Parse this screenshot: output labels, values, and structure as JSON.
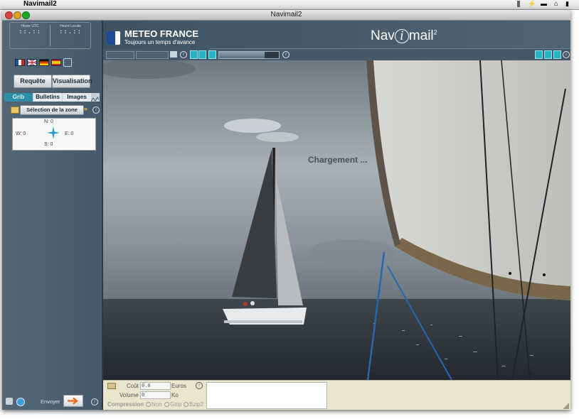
{
  "menubar": {
    "app_name": "Navimail2"
  },
  "window": {
    "title": "Navimail2"
  },
  "clocks": {
    "utc_label": "Heure UTC",
    "local_label": "Heure Locale",
    "utc_value": "::.::",
    "local_value": "::.::"
  },
  "languages": [
    "fr",
    "en",
    "de",
    "es",
    "other"
  ],
  "mode_buttons": {
    "request": "Requête",
    "visualisation": "Visualisation"
  },
  "tabs": {
    "grib": "Grib",
    "bulletins": "Bulletins",
    "images": "Images"
  },
  "zone": {
    "select_label": "Sélection de la zone",
    "north": "N: 0",
    "west": "W: 0",
    "east": "E: 0",
    "south": "S: 0"
  },
  "send": {
    "label": "Envoyer"
  },
  "header": {
    "brand_name": "METEO FRANCE",
    "brand_tagline": "Toujours un temps d'avance",
    "product_name_left": "Nav",
    "product_name_i": "i",
    "product_name_right": "mail",
    "product_superscript": "2"
  },
  "viewer": {
    "loading_text": "Chargement ..."
  },
  "bottom": {
    "cost_label": "Coût",
    "cost_value": "0.0",
    "cost_unit": "Euros",
    "volume_label": "Volume",
    "volume_value": "0",
    "volume_unit": "Ko",
    "compression_label": "Compression",
    "compression_options": [
      "Non",
      "Gzip",
      "Bzip2"
    ]
  },
  "colors": {
    "sidebar": "#4c5f6f",
    "accent_cyan": "#27b3c4",
    "bottom_panel": "#e9e6cd",
    "send_arrow": "#e86a1a"
  }
}
